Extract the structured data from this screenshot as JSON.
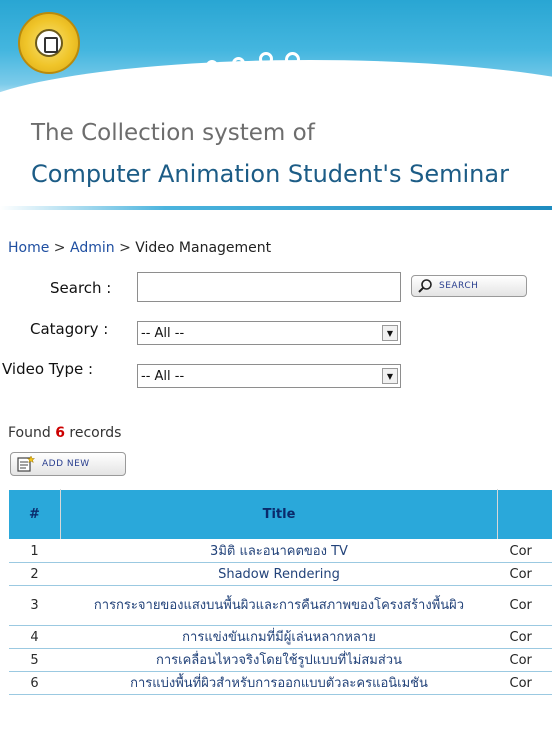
{
  "header": {
    "line1": "The Collection system of",
    "line2": "Computer Animation Student's Seminar"
  },
  "breadcrumb": {
    "home": "Home",
    "sep": ">",
    "admin": "Admin",
    "current": "Video Management"
  },
  "search": {
    "label": "Search :",
    "value": "",
    "button": "SEARCH"
  },
  "category": {
    "label": "Catagory :",
    "selected": "-- All --"
  },
  "video_type": {
    "label": "Video Type :",
    "selected": "-- All --"
  },
  "found": {
    "prefix": "Found",
    "count": "6",
    "suffix": "records"
  },
  "add_new": "ADD NEW",
  "table": {
    "headers": [
      "#",
      "Title"
    ],
    "rows": [
      {
        "n": "1",
        "title": "3มิติ และอนาคตของ TV",
        "col3": "Cor"
      },
      {
        "n": "2",
        "title": "Shadow Rendering",
        "col3": "Cor"
      },
      {
        "n": "3",
        "title": "การกระจายของแสงบนพื้นผิวและการคืนสภาพของโครงสร้างพื้นผิว",
        "col3": "Cor"
      },
      {
        "n": "4",
        "title": "การแข่งขันเกมที่มีผู้เล่นหลากหลาย",
        "col3": "Cor"
      },
      {
        "n": "5",
        "title": "การเคลื่อนไหวจริงโดยใช้รูปแบบที่ไม่สมส่วน",
        "col3": "Cor"
      },
      {
        "n": "6",
        "title": "การแบ่งพื้นที่ผิวสำหรับการออกแบบตัวละครแอนิเมชัน",
        "col3": "Cor"
      }
    ]
  }
}
